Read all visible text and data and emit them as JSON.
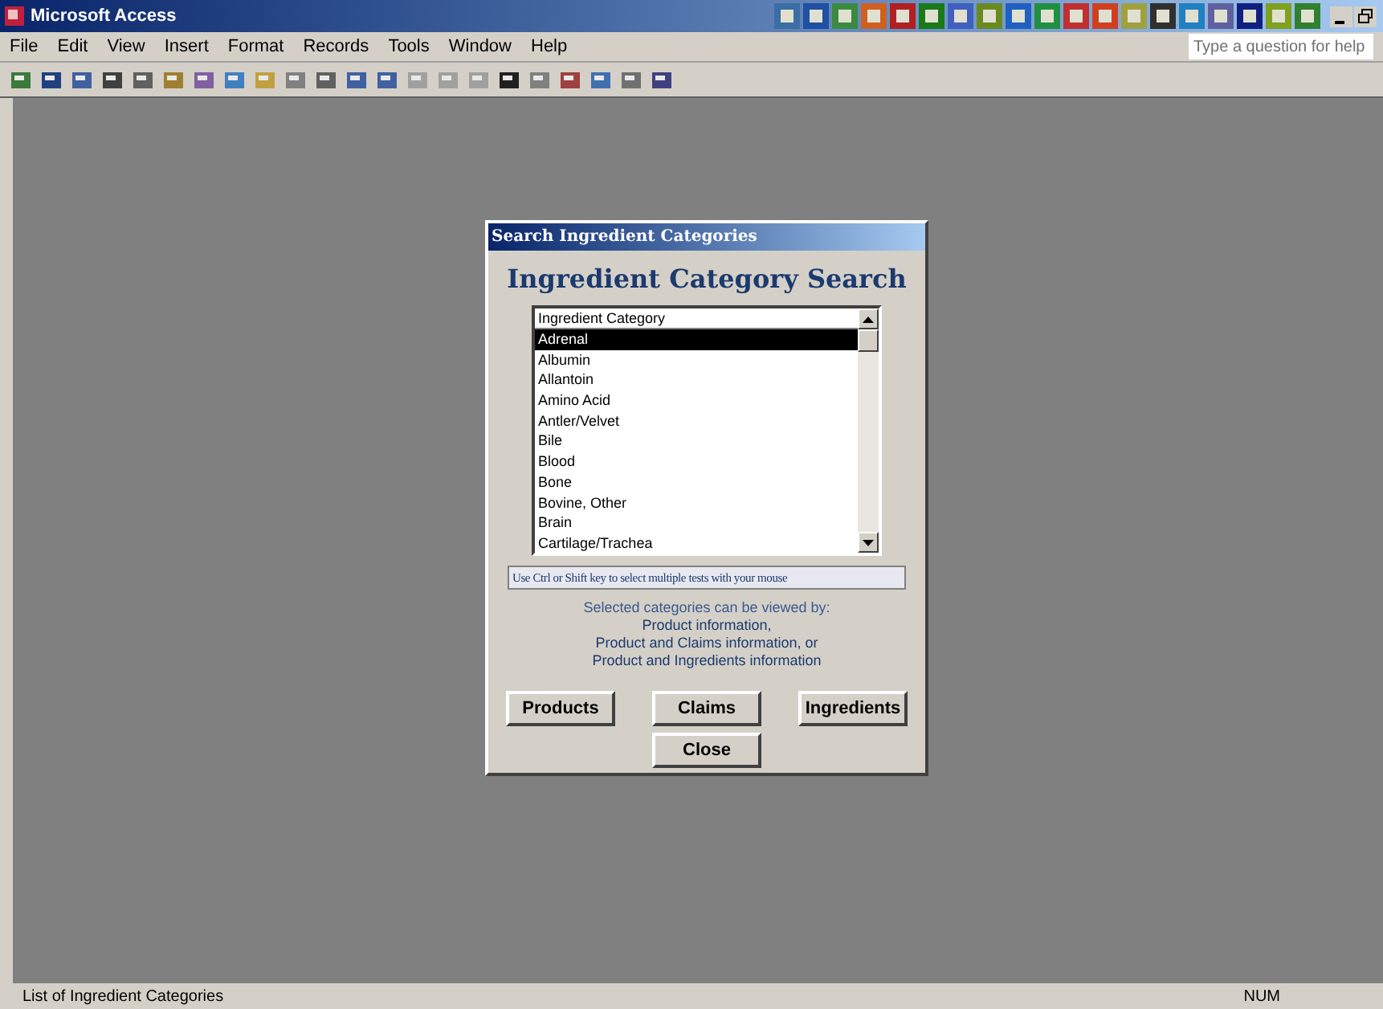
{
  "window": {
    "title": "Microsoft Access"
  },
  "menu": [
    "File",
    "Edit",
    "View",
    "Insert",
    "Format",
    "Records",
    "Tools",
    "Window",
    "Help"
  ],
  "help_box": {
    "placeholder": "Type a question for help"
  },
  "dialog": {
    "title": "Search Ingredient Categories",
    "heading": "Ingredient Category Search",
    "list": {
      "column": "Ingredient Category",
      "items": [
        {
          "label": "Adrenal",
          "selected": true
        },
        {
          "label": "Albumin",
          "selected": false
        },
        {
          "label": "Allantoin",
          "selected": false
        },
        {
          "label": "Amino Acid",
          "selected": false
        },
        {
          "label": "Antler/Velvet",
          "selected": false
        },
        {
          "label": "Bile",
          "selected": false
        },
        {
          "label": "Blood",
          "selected": false
        },
        {
          "label": "Bone",
          "selected": false
        },
        {
          "label": "Bovine, Other",
          "selected": false
        },
        {
          "label": "Brain",
          "selected": false
        },
        {
          "label": "Cartilage/Trachea",
          "selected": false
        }
      ]
    },
    "hint": "Use Ctrl or Shift key to select multiple tests with your mouse",
    "info": [
      "Selected categories can be viewed by:",
      "Product information,",
      "Product and Claims information, or",
      "Product and Ingredients information"
    ],
    "buttons": [
      "Products",
      "Claims",
      "Ingredients"
    ],
    "close_button": "Close"
  },
  "status_bar": {
    "text": "List of Ingredient Categories",
    "indicator": "NUM"
  }
}
